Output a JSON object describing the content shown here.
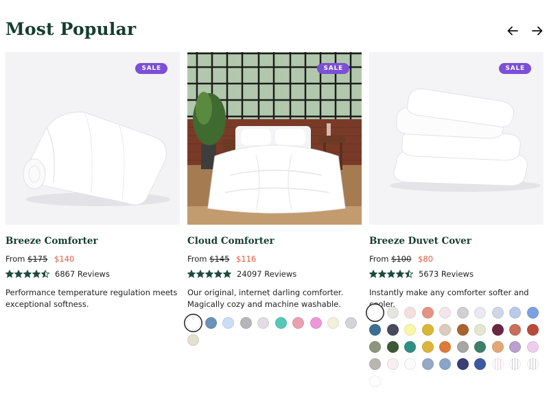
{
  "section": {
    "title": "Most Popular"
  },
  "nav": {
    "prev_icon": "arrow-left-icon",
    "next_icon": "arrow-right-icon"
  },
  "products": [
    {
      "badge": "SALE",
      "name": "Breeze Comforter",
      "price_prefix": "From",
      "original_price": "$175",
      "sale_price": "$140",
      "rating": 4.5,
      "reviews": "6867 Reviews",
      "description": "Performance temperature regulation meets exceptional softness.",
      "swatches": []
    },
    {
      "badge": "SALE",
      "name": "Cloud Comforter",
      "price_prefix": "From",
      "original_price": "$145",
      "sale_price": "$116",
      "rating": 5,
      "reviews": "24097 Reviews",
      "description": "Our original, internet darling comforter. Magically cozy and machine washable.",
      "swatches": [
        "#ffffff",
        "#6b93b7",
        "#cdddf5",
        "#b6b6ba",
        "#e1dde2",
        "#55c9b8",
        "#e9a1b3",
        "#ee96d8",
        "#f2f0d9",
        "#d4d4d8",
        "#e2e1cf"
      ]
    },
    {
      "badge": "SALE",
      "name": "Breeze Duvet Cover",
      "price_prefix": "From",
      "original_price": "$100",
      "sale_price": "$80",
      "rating": 4.5,
      "reviews": "5673 Reviews",
      "description": "Instantly make any comforter softer and cooler.",
      "swatches": [
        "#ffffff",
        "#e6e6e1",
        "#f4dfe0",
        "#e39485",
        "#f3e6ec",
        "#d0cfd4",
        "#e8e9f3",
        "#ced6e8",
        "#b9cbe8",
        "#7ea0e2",
        "#3c6f93",
        "#4a4a5e",
        "#f9f5a9",
        "#d8b638",
        "#dccbbd",
        "#a7642d",
        "#e3e7cf",
        "#6a2840",
        "#c96f5e",
        "#b84a3a",
        "#8f947d",
        "#3c5834",
        "#2f8f84",
        "#dcb43a",
        "#dc7a37",
        "#a6a7a4",
        "#3f7f6a",
        "#e4a777",
        "#b8a1cc",
        "#efcdec",
        "#b7b6b0",
        "#f6eef0",
        "#fbfbfb",
        "#95a8c6",
        "#8ba5c9",
        "#3b3f75",
        "#3d59a1",
        "stripe-soft",
        "stripe",
        "stripe",
        "#ffffff"
      ]
    }
  ],
  "colors": {
    "title": "#163d30",
    "badge": "#7b4fd6",
    "sale_price": "#e05a3c",
    "stars": "#1f4a3d"
  }
}
